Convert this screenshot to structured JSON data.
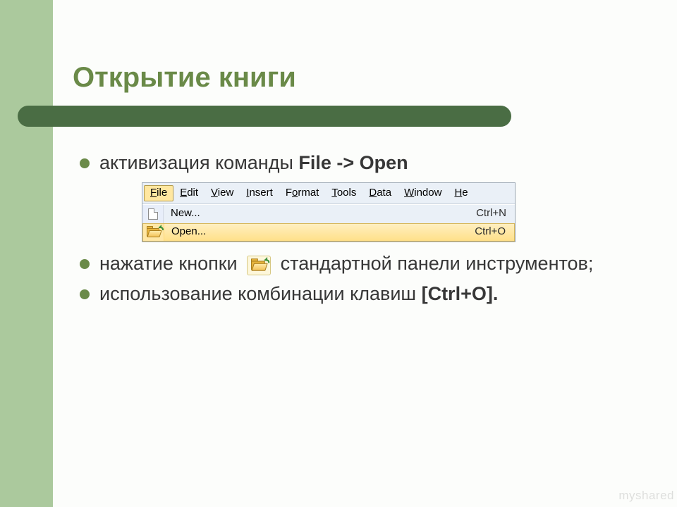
{
  "title": "Открытие книги",
  "bullets": {
    "b1_prefix": "активизация команды ",
    "b1_bold": "File -> Open",
    "b2_before": "нажатие кнопки ",
    "b2_after": " стандартной панели инструментов;",
    "b3_prefix": "использование комбинации клавиш ",
    "b3_bold": "[Ctrl+O]."
  },
  "menubar": {
    "items": [
      {
        "underline": "F",
        "rest": "ile"
      },
      {
        "underline": "E",
        "rest": "dit"
      },
      {
        "underline": "V",
        "rest": "iew"
      },
      {
        "underline": "I",
        "rest": "nsert"
      },
      {
        "underline": "",
        "rest_before": "F",
        "u2": "o",
        "rest": "rmat"
      },
      {
        "underline": "T",
        "rest": "ools"
      },
      {
        "underline": "D",
        "rest": "ata"
      },
      {
        "underline": "W",
        "rest": "indow"
      },
      {
        "underline": "H",
        "rest": "e"
      }
    ],
    "dropdown": [
      {
        "icon": "doc",
        "u": "N",
        "rest": "ew...",
        "shortcut": "Ctrl+N",
        "highlight": false
      },
      {
        "icon": "folder",
        "u": "O",
        "rest": "pen...",
        "shortcut": "Ctrl+O",
        "highlight": true
      }
    ]
  },
  "watermark": "myshared"
}
